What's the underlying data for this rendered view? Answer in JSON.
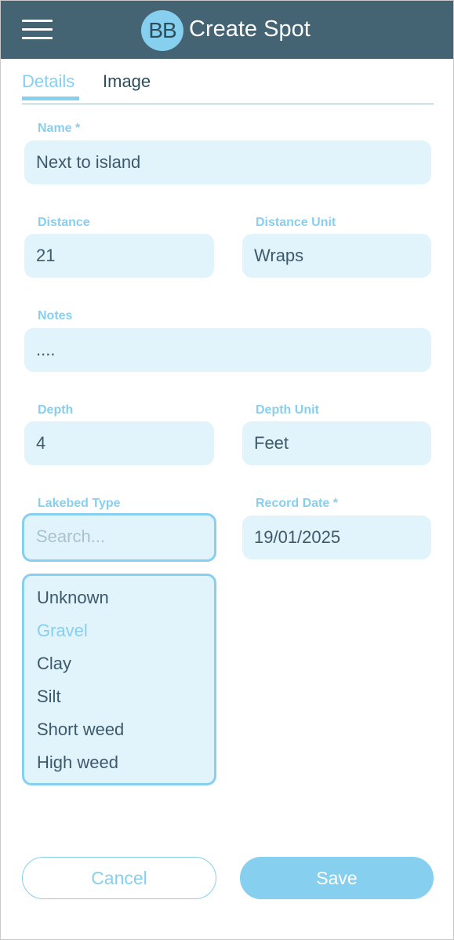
{
  "header": {
    "logo_text": "BB",
    "title": "Create Spot",
    "menu_icon": "hamburger-menu-icon",
    "background_color": "#446473"
  },
  "tabs": [
    {
      "label": "Details",
      "active": true
    },
    {
      "label": "Image",
      "active": false
    }
  ],
  "form": {
    "name": {
      "label": "Name *",
      "value": "Next to island"
    },
    "distance": {
      "label": "Distance",
      "value": "21"
    },
    "distance_unit": {
      "label": "Distance Unit",
      "value": "Wraps"
    },
    "notes": {
      "label": "Notes",
      "value": "...."
    },
    "depth": {
      "label": "Depth",
      "value": "4"
    },
    "depth_unit": {
      "label": "Depth Unit",
      "value": "Feet"
    },
    "lakebed_type": {
      "label": "Lakebed Type",
      "placeholder": "Search...",
      "options": [
        "Unknown",
        "Gravel",
        "Clay",
        "Silt",
        "Short weed",
        "High weed"
      ],
      "selected": "Gravel"
    },
    "record_date": {
      "label": "Record Date *",
      "value": "19/01/2025"
    }
  },
  "buttons": {
    "cancel": "Cancel",
    "save": "Save"
  },
  "colors": {
    "accent": "#87cfef",
    "field_background": "#e1f3fb",
    "text": "#3d5a6c"
  }
}
